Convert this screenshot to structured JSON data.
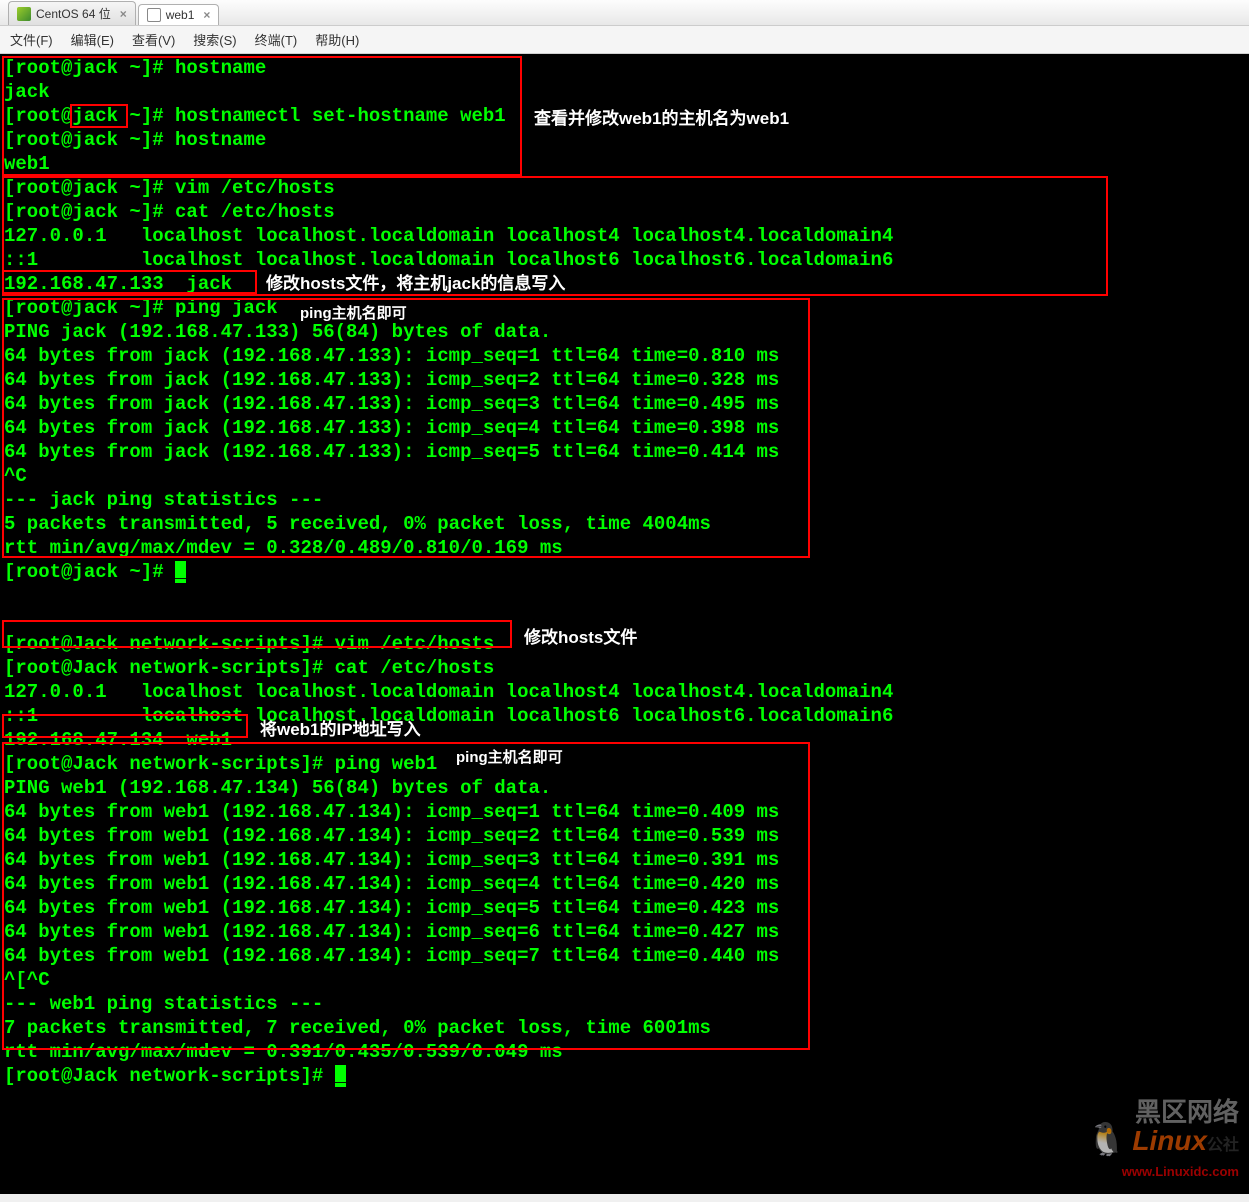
{
  "tabs": {
    "tab1": "CentOS 64 位",
    "tab2": "web1"
  },
  "menu": {
    "file": "文件(F)",
    "edit": "编辑(E)",
    "view": "查看(V)",
    "search": "搜索(S)",
    "terminal": "终端(T)",
    "help": "帮助(H)"
  },
  "term": {
    "l1": "[root@jack ~]# hostname",
    "l2": "jack",
    "l3": "[root@jack ~]# hostnamectl set-hostname web1",
    "l4": "[root@jack ~]# hostname",
    "l5": "web1",
    "l6": "[root@jack ~]# vim /etc/hosts",
    "l7": "[root@jack ~]# cat /etc/hosts",
    "l8": "127.0.0.1   localhost localhost.localdomain localhost4 localhost4.localdomain4",
    "l9": "::1         localhost localhost.localdomain localhost6 localhost6.localdomain6",
    "l10": "192.168.47.133  jack",
    "l11": "[root@jack ~]# ping jack",
    "l12": "PING jack (192.168.47.133) 56(84) bytes of data.",
    "l13": "64 bytes from jack (192.168.47.133): icmp_seq=1 ttl=64 time=0.810 ms",
    "l14": "64 bytes from jack (192.168.47.133): icmp_seq=2 ttl=64 time=0.328 ms",
    "l15": "64 bytes from jack (192.168.47.133): icmp_seq=3 ttl=64 time=0.495 ms",
    "l16": "64 bytes from jack (192.168.47.133): icmp_seq=4 ttl=64 time=0.398 ms",
    "l17": "64 bytes from jack (192.168.47.133): icmp_seq=5 ttl=64 time=0.414 ms",
    "l18": "^C",
    "l19": "--- jack ping statistics ---",
    "l20": "5 packets transmitted, 5 received, 0% packet loss, time 4004ms",
    "l21": "rtt min/avg/max/mdev = 0.328/0.489/0.810/0.169 ms",
    "l22": "[root@jack ~]# ",
    "l23": " ",
    "l24": " ",
    "l25": "[root@Jack network-scripts]# vim /etc/hosts",
    "l26": "[root@Jack network-scripts]# cat /etc/hosts",
    "l27": "127.0.0.1   localhost localhost.localdomain localhost4 localhost4.localdomain4",
    "l28": "::1         localhost localhost.localdomain localhost6 localhost6.localdomain6",
    "l29": "192.168.47.134  web1",
    "l30": "[root@Jack network-scripts]# ping web1",
    "l31": "PING web1 (192.168.47.134) 56(84) bytes of data.",
    "l32": "64 bytes from web1 (192.168.47.134): icmp_seq=1 ttl=64 time=0.409 ms",
    "l33": "64 bytes from web1 (192.168.47.134): icmp_seq=2 ttl=64 time=0.539 ms",
    "l34": "64 bytes from web1 (192.168.47.134): icmp_seq=3 ttl=64 time=0.391 ms",
    "l35": "64 bytes from web1 (192.168.47.134): icmp_seq=4 ttl=64 time=0.420 ms",
    "l36": "64 bytes from web1 (192.168.47.134): icmp_seq=5 ttl=64 time=0.423 ms",
    "l37": "64 bytes from web1 (192.168.47.134): icmp_seq=6 ttl=64 time=0.427 ms",
    "l38": "64 bytes from web1 (192.168.47.134): icmp_seq=7 ttl=64 time=0.440 ms",
    "l39": "^[^C",
    "l40": "--- web1 ping statistics ---",
    "l41": "7 packets transmitted, 7 received, 0% packet loss, time 6001ms",
    "l42": "rtt min/avg/max/mdev = 0.391/0.435/0.539/0.049 ms",
    "l43": "[root@Jack network-scripts]# "
  },
  "annotations": {
    "a1": "查看并修改web1的主机名为web1",
    "a2": "修改hosts文件，将主机jack的信息写入",
    "a3": "ping主机名即可",
    "a4": "修改hosts文件",
    "a5": "将web1的IP地址写入",
    "a6": "ping主机名即可"
  },
  "watermark": {
    "heiqu": "黑区网络",
    "logo": "Linux",
    "suffix": "公社",
    "url": "www.Linuxidc.com"
  }
}
